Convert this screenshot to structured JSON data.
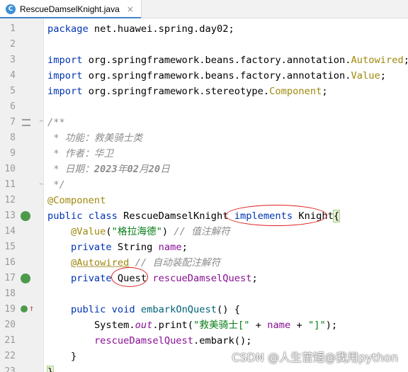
{
  "tab": {
    "filename": "RescueDamselKnight.java",
    "icon_letter": "C",
    "close": "×"
  },
  "lines": [
    {
      "n": "1"
    },
    {
      "n": "2"
    },
    {
      "n": "3"
    },
    {
      "n": "4"
    },
    {
      "n": "5"
    },
    {
      "n": "6"
    },
    {
      "n": "7"
    },
    {
      "n": "8"
    },
    {
      "n": "9"
    },
    {
      "n": "10"
    },
    {
      "n": "11"
    },
    {
      "n": "12"
    },
    {
      "n": "13"
    },
    {
      "n": "14"
    },
    {
      "n": "15"
    },
    {
      "n": "16"
    },
    {
      "n": "17"
    },
    {
      "n": "18"
    },
    {
      "n": "19"
    },
    {
      "n": "20"
    },
    {
      "n": "21"
    },
    {
      "n": "22"
    },
    {
      "n": "23"
    }
  ],
  "code": {
    "l1": {
      "kw": "package",
      "rest": " net.huawei.spring.day02;"
    },
    "l3": {
      "kw": "import",
      "pkg": " org.springframework.beans.factory.annotation.",
      "cls": "Autowired",
      "end": ";"
    },
    "l4": {
      "kw": "import",
      "pkg": " org.springframework.beans.factory.annotation.",
      "cls": "Value",
      "end": ";"
    },
    "l5": {
      "kw": "import",
      "pkg": " org.springframework.stereotype.",
      "cls": "Component",
      "end": ";"
    },
    "l7": {
      "text": "/**"
    },
    "l8": {
      "text": " * 功能：救美骑士类"
    },
    "l9": {
      "text": " * 作者：华卫"
    },
    "l10": {
      "pre": " * 日期：",
      "bold1": "2023",
      "mid1": "年",
      "bold2": "02",
      "mid2": "月",
      "bold3": "20",
      "post": "日"
    },
    "l11": {
      "text": " */"
    },
    "l12": {
      "text": "@Component"
    },
    "l13": {
      "kw1": "public",
      "kw2": "class",
      "name": " RescueDamselKnight ",
      "impl": "implements",
      "iface": " Knight",
      "brace": "{"
    },
    "l14": {
      "anno": "@Value",
      "open": "(",
      "str": "\"格拉海德\"",
      "close": ")",
      "cmt": " // 值注解符"
    },
    "l15": {
      "kw": "private",
      "type": " String ",
      "field": "name",
      "end": ";"
    },
    "l16": {
      "anno": "@Autowired",
      "cmt": " // 自动装配注解符"
    },
    "l17": {
      "kw": "private",
      "type": "Quest",
      "field": " rescueDamselQuest",
      "end": ";"
    },
    "l19": {
      "kw1": "public",
      "kw2": "void",
      "fn": " embarkOnQuest",
      "end": "() {"
    },
    "l20": {
      "obj": "System.",
      "static": "out",
      "call": ".print(",
      "str": "\"救美骑士[\"",
      "plus": " + ",
      "field": "name",
      "plus2": " + ",
      "str2": "\"]\"",
      "end": ");"
    },
    "l21": {
      "field": "rescueDamselQuest",
      "call": ".embark();"
    },
    "l22": {
      "text": "}"
    },
    "l23": {
      "text": "}"
    }
  },
  "watermark": "CSDN @人生苦短@我用python",
  "colors": {
    "keyword": "#0033b3",
    "annotation": "#9e880d",
    "comment": "#8c8c8c",
    "string": "#067d17",
    "field": "#871094",
    "method": "#00627a",
    "highlight": "#e02020"
  }
}
